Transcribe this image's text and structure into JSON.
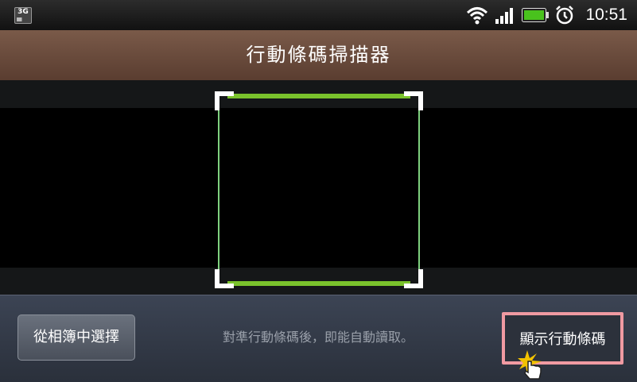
{
  "statusbar": {
    "network_badge": "3G",
    "time": "10:51",
    "icons": [
      "network-3g-icon",
      "wifi-icon",
      "signal-icon",
      "battery-icon",
      "alarm-icon"
    ]
  },
  "header": {
    "title": "行動條碼掃描器"
  },
  "footer": {
    "album_button": "從相簿中選擇",
    "hint": "對準行動條碼後，即能自動讀取。",
    "show_button": "顯示行動條碼"
  },
  "colors": {
    "title_bar": "#6b4c3c",
    "frame_edge": "#7ac22c",
    "frame_side": "#7ed07e",
    "bottom_bar": "#343a46",
    "highlight": "#f09aa2"
  }
}
